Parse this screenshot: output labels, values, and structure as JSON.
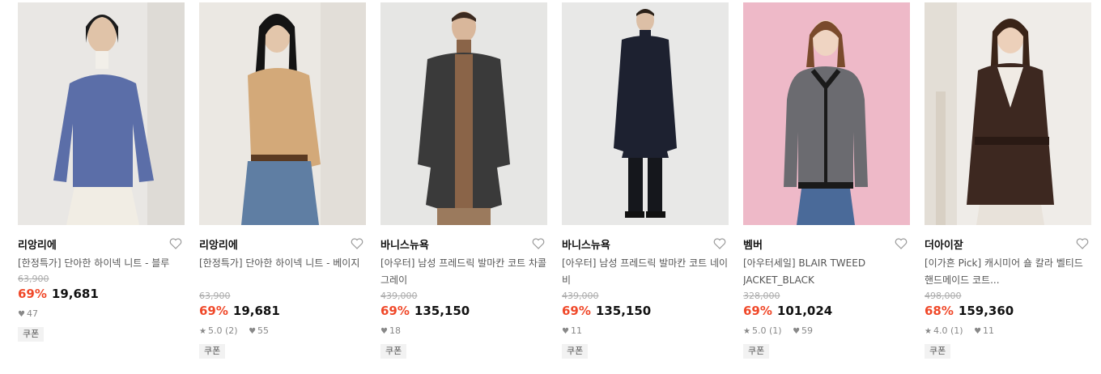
{
  "products": [
    {
      "brand": "리앙리에",
      "title": "[한정특가] 단아한 하이넥 니트 - 블루",
      "original_price": "63,900",
      "discount": "69%",
      "price": "19,681",
      "rating": "",
      "reviews": "",
      "likes": "47",
      "coupon": "쿠폰",
      "bg": "#e9e7e4",
      "accent": "#5b6ea8"
    },
    {
      "brand": "리앙리에",
      "title": "[한정특가] 단아한 하이넥 니트 - 베이지",
      "original_price": "63,900",
      "discount": "69%",
      "price": "19,681",
      "rating": "5.0",
      "reviews": "(2)",
      "likes": "55",
      "coupon": "쿠폰",
      "bg": "#ebe8e3",
      "accent": "#d3a979"
    },
    {
      "brand": "바니스뉴욕",
      "title": "[아우터] 남성 프레드릭 발마칸 코트 차콜그레이",
      "original_price": "439,000",
      "discount": "69%",
      "price": "135,150",
      "rating": "",
      "reviews": "",
      "likes": "18",
      "coupon": "쿠폰",
      "bg": "#e6e6e4",
      "accent": "#3a3a3a"
    },
    {
      "brand": "바니스뉴욕",
      "title": "[아우터] 남성 프레드릭 발마칸 코트 네이비",
      "original_price": "439,000",
      "discount": "69%",
      "price": "135,150",
      "rating": "",
      "reviews": "",
      "likes": "11",
      "coupon": "쿠폰",
      "bg": "#e8e8e7",
      "accent": "#1d2130"
    },
    {
      "brand": "벰버",
      "title": "[아우터세일] BLAIR TWEED JACKET_BLACK",
      "original_price": "328,000",
      "discount": "69%",
      "price": "101,024",
      "rating": "5.0",
      "reviews": "(1)",
      "likes": "59",
      "coupon": "쿠폰",
      "bg": "#eeb9c8",
      "accent": "#6b6b70"
    },
    {
      "brand": "더아이잗",
      "title": "[이가흔 Pick] 캐시미어 숄 칼라 벨티드 핸드메이드 코트...",
      "original_price": "498,000",
      "discount": "68%",
      "price": "159,360",
      "rating": "4.0",
      "reviews": "(1)",
      "likes": "11",
      "coupon": "쿠폰",
      "bg": "#efece8",
      "accent": "#3d2820"
    }
  ],
  "colors": {
    "discount": "#f0492a",
    "strike": "#aaaaaa"
  }
}
